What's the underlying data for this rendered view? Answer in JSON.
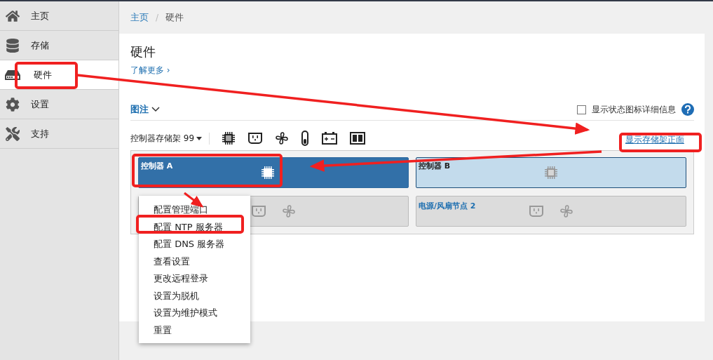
{
  "sidebar": {
    "items": [
      {
        "label": "主页",
        "selected": false
      },
      {
        "label": "存储",
        "selected": false
      },
      {
        "label": "硬件",
        "selected": true
      },
      {
        "label": "设置",
        "selected": false
      },
      {
        "label": "支持",
        "selected": false
      }
    ]
  },
  "breadcrumb": {
    "items": [
      "主页",
      "硬件"
    ],
    "separator": "/"
  },
  "page": {
    "title": "硬件",
    "learn_more": "了解更多 ›"
  },
  "legend": {
    "label": "图注",
    "expanded": false
  },
  "status_details": {
    "label": "显示状态图标详细信息",
    "checked": false
  },
  "shelf": {
    "selector": "控制器存储架 99",
    "show_front_link": "显示存储架正面"
  },
  "controllers": [
    {
      "label": "控制器 A",
      "selected": true
    },
    {
      "label": "控制器 B",
      "selected": false
    }
  ],
  "nodes": [
    {
      "kind": "covered"
    },
    {
      "kind": "labeled",
      "label": "电源/风扇节点 2"
    }
  ],
  "context_menu": [
    "配置管理端口",
    "配置 NTP 服务器",
    "配置 DNS 服务器",
    "查看设置",
    "更改远程登录",
    "设置为脱机",
    "设置为维护模式",
    "重置"
  ]
}
